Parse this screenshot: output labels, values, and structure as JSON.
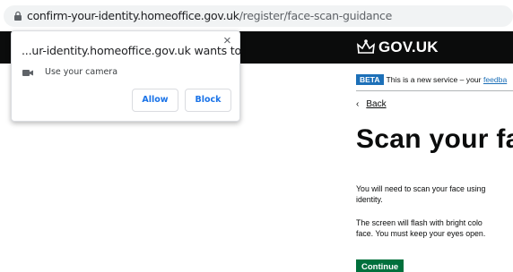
{
  "browser": {
    "url_host": "confirm-your-identity.homeoffice.gov.uk",
    "url_path": "/register/face-scan-guidance",
    "icon": "lock-icon"
  },
  "permission_popup": {
    "title": "...ur-identity.homeoffice.gov.uk wants to",
    "close": "×",
    "permission": "Use your camera",
    "permission_icon": "camera-icon",
    "allow_label": "Allow",
    "block_label": "Block"
  },
  "page": {
    "logo_text": "GOV.UK",
    "beta_tag": "BETA",
    "beta_text": "This is a new service – your",
    "beta_link": "feedba",
    "back_label": "Back",
    "heading": "Scan your face",
    "para1_line1": "You will need to scan your face using",
    "para1_line2": "identity.",
    "para2_line1": "The screen will flash with bright colo",
    "para2_line2": "face. You must keep your eyes open.",
    "continue_label": "Continue"
  },
  "colors": {
    "govuk_black": "#0b0c0c",
    "beta_blue": "#1d70b8",
    "continue_green": "#00703c",
    "chrome_blue": "#1a73e8"
  }
}
